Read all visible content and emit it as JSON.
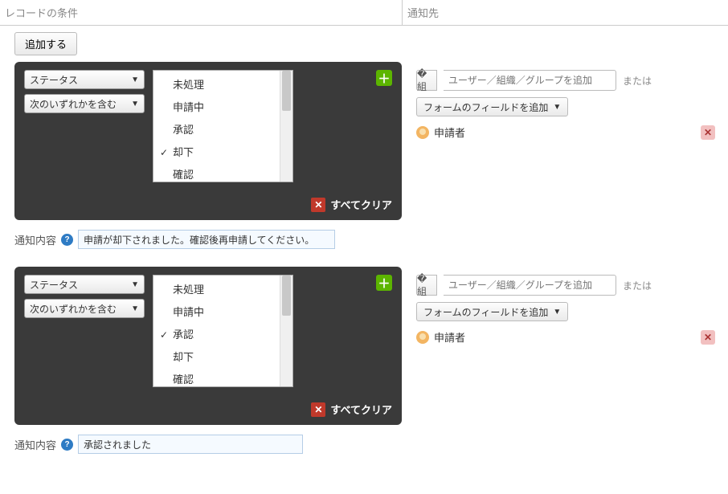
{
  "headers": {
    "left": "レコードの条件",
    "right": "通知先"
  },
  "add_button": "追加する",
  "clear_all": "すべてクリア",
  "or_text": "または",
  "form_field_button": "フォームのフィールドを追加",
  "recip_placeholder": "ユーザー／組織／グループを追加",
  "notif_label": "通知内容",
  "blocks": [
    {
      "select1": "ステータス",
      "select2": "次のいずれかを含む",
      "options": [
        {
          "label": "未処理",
          "checked": false
        },
        {
          "label": "申請中",
          "checked": false
        },
        {
          "label": "承認",
          "checked": false
        },
        {
          "label": "却下",
          "checked": true
        },
        {
          "label": "確認",
          "checked": false
        }
      ],
      "notif_value": "申請が却下されました。確認後再申請してください。",
      "recipients": [
        {
          "name": "申請者"
        }
      ]
    },
    {
      "select1": "ステータス",
      "select2": "次のいずれかを含む",
      "options": [
        {
          "label": "未処理",
          "checked": false
        },
        {
          "label": "申請中",
          "checked": false
        },
        {
          "label": "承認",
          "checked": true
        },
        {
          "label": "却下",
          "checked": false
        },
        {
          "label": "確認",
          "checked": false
        }
      ],
      "notif_value": "承認されました",
      "recipients": [
        {
          "name": "申請者"
        }
      ]
    }
  ]
}
